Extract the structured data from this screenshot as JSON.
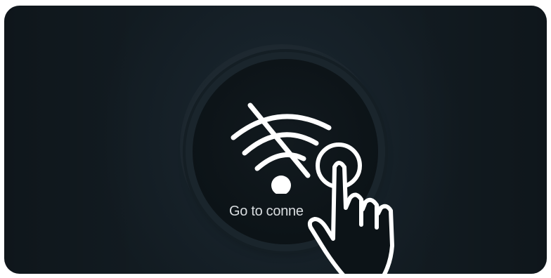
{
  "screen": {
    "connect_button": {
      "label": "Go to conne",
      "icon": "wifi-off-icon"
    },
    "overlay_icon": "hand-pointer-icon"
  },
  "colors": {
    "background": "#17222a",
    "button": "#0c1317",
    "icon": "#ffffff",
    "label": "#d9dde0"
  }
}
